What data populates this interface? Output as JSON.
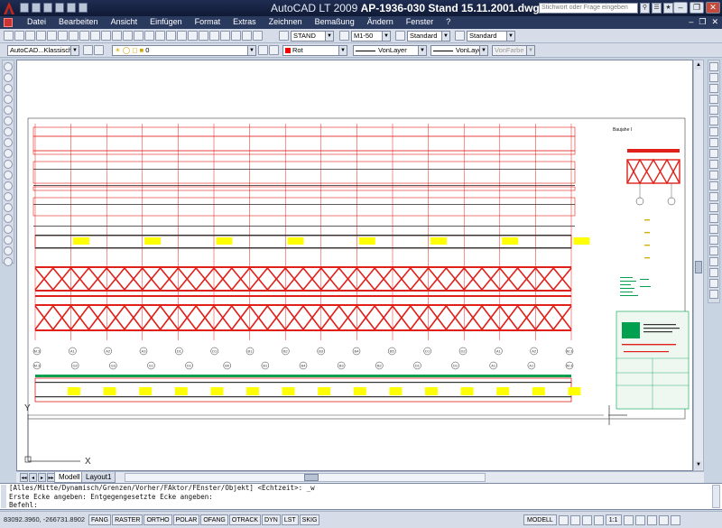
{
  "window": {
    "app_title": "AutoCAD LT 2009",
    "doc_title": "AP-1936-030 Stand 15.11.2001.dwg",
    "search_placeholder": "Stichwort oder Frage eingeben"
  },
  "menu": [
    "Datei",
    "Bearbeiten",
    "Ansicht",
    "Einfügen",
    "Format",
    "Extras",
    "Zeichnen",
    "Bemaßung",
    "Ändern",
    "Fenster",
    "?"
  ],
  "toolbar1": {
    "text_style": "STAND",
    "dim_style": "M1-50",
    "table_style": "Standard",
    "multileader_style": "Standard"
  },
  "toolbar2": {
    "workspace": "AutoCAD...Klassisch",
    "layer": "0",
    "color": "Rot",
    "linetype": "VonLayer",
    "lineweight": "VonLayer",
    "plotstyle": "VonFarbe"
  },
  "tabs": {
    "model": "Modell",
    "layout": "Layout1"
  },
  "ucs": {
    "x_label": "X",
    "y_label": "Y"
  },
  "command": {
    "line1": "[Alles/Mitte/Dynamisch/Grenzen/Vorher/FAktor/FEnster/Objekt] <Echtzeit>: _w",
    "line2": "Erste Ecke angeben: Entgegengesetzte Ecke angeben:",
    "prompt": "Befehl:"
  },
  "status": {
    "coords": "83092.3960, -266731.8902",
    "buttons": [
      "FANG",
      "RASTER",
      "ORTHO",
      "POLAR",
      "OFANG",
      "OTRACK",
      "DYN",
      "LST",
      "SKIG"
    ],
    "model": "MODELL",
    "scale": "1:1"
  },
  "drawing": {
    "detail_title": "Baujahe I",
    "axis_labels_row1": [
      "M.3",
      "A1",
      "A2",
      "A3",
      "D1",
      "D1",
      "B1",
      "B2",
      "B3",
      "B4",
      "B5",
      "D1",
      "D2",
      "A1",
      "A2",
      "M.3"
    ],
    "axis_labels_row2": [
      "M.3",
      "G2",
      "G3",
      "G1",
      "D1",
      "B0",
      "B1",
      "B4",
      "B3",
      "B2",
      "D1",
      "D1",
      "A1",
      "A1",
      "M.3"
    ],
    "colors": {
      "red": "#e0201a",
      "dark": "#333333",
      "yellow": "#ffff00",
      "green": "#00a050"
    }
  }
}
